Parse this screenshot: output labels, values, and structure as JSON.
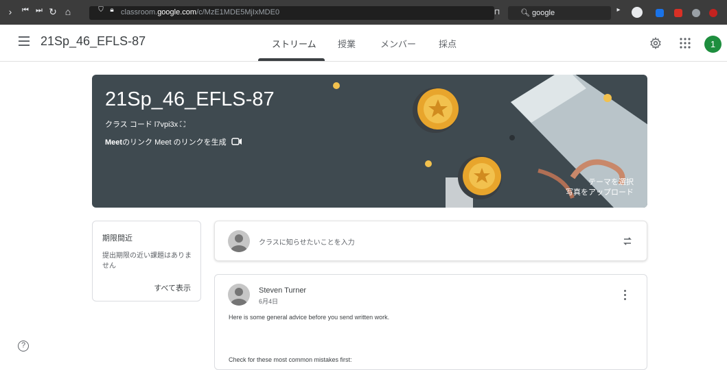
{
  "browser": {
    "url_prefix": "classroom.",
    "url_domain": "google.com",
    "url_path": "/c/MzE1MDE5MjIxMDE0",
    "search_text": "google",
    "nav_icons": [
      "chevron-right-icon",
      "skip-back-icon",
      "skip-forward-icon",
      "reload-icon",
      "home-icon",
      "shield-icon",
      "lock-icon"
    ]
  },
  "header": {
    "title": "21Sp_46_EFLS-87",
    "tabs": [
      {
        "label": "ストリーム",
        "active": true
      },
      {
        "label": "授業",
        "active": false
      },
      {
        "label": "メンバー",
        "active": false
      },
      {
        "label": "採点",
        "active": false
      }
    ],
    "avatar_initial": "1"
  },
  "banner": {
    "title": "21Sp_46_EFLS-87",
    "class_code_label": "クラス コード",
    "class_code": "l7vpi3x",
    "meet_label": "Meet",
    "meet_link_text": "のリンク",
    "meet_generate": "Meet のリンクを生成",
    "select_theme": "テーマを選択",
    "upload_photo": "写真をアップロード"
  },
  "upcoming": {
    "title": "期限間近",
    "body": "提出期限の近い課題はありません",
    "view_all": "すべて表示"
  },
  "announce": {
    "placeholder": "クラスに知らせたいことを入力"
  },
  "post": {
    "author": "Steven Turner",
    "date": "6月4日",
    "line1": "Here is some general advice before you send written work.",
    "line2": "Check for these most common mistakes first:"
  },
  "help_label": "?",
  "colors": {
    "banner": "#3f4a50",
    "avatar": "#1e8e3e",
    "chrome": "#3c3c3c"
  }
}
